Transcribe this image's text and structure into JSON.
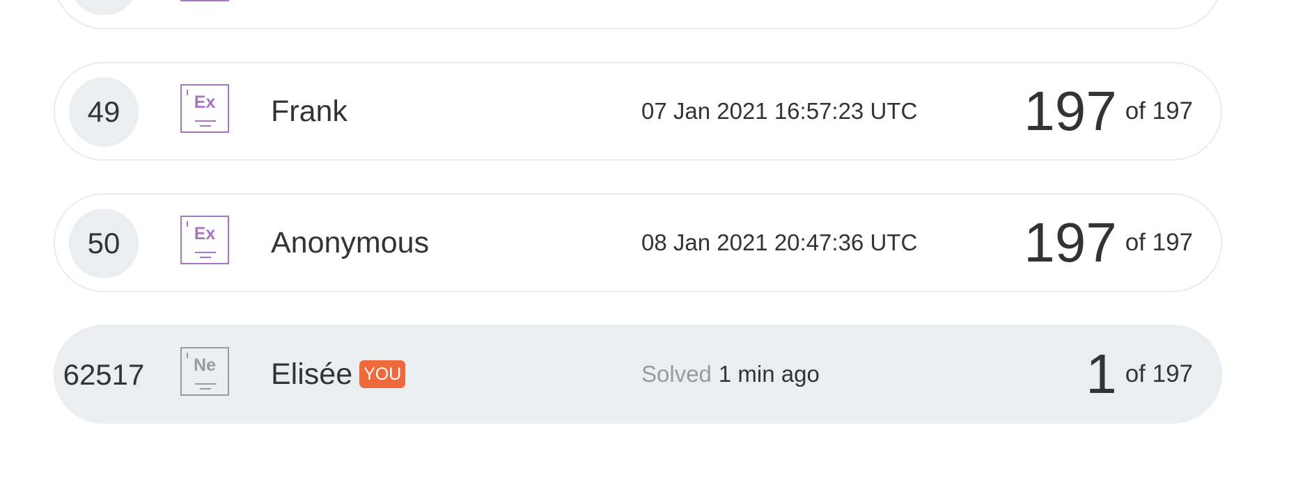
{
  "leaderboard": {
    "rows": [
      {
        "rank": "",
        "badge_symbol": "",
        "name": "",
        "solved_date": "",
        "score": "",
        "total_label": ""
      },
      {
        "rank": "49",
        "badge_symbol": "Ex",
        "badge_color": "#a874c6",
        "name": "Frank",
        "solved_date": "07 Jan 2021 16:57:23 UTC",
        "score": "197",
        "total_label": "of 197"
      },
      {
        "rank": "50",
        "badge_symbol": "Ex",
        "badge_color": "#a874c6",
        "name": "Anonymous",
        "solved_date": "08 Jan 2021 20:47:36 UTC",
        "score": "197",
        "total_label": "of 197"
      }
    ],
    "current_user": {
      "rank": "62517",
      "badge_symbol": "Ne",
      "badge_color": "#9a9a9a",
      "name": "Elisée",
      "you_label": "YOU",
      "you_label_color": "#ee6a3c",
      "solved_prefix": "Solved",
      "solved_time": "1 min ago",
      "score": "1",
      "total_label": "of 197",
      "highlight_color": "#ebeef1"
    }
  }
}
